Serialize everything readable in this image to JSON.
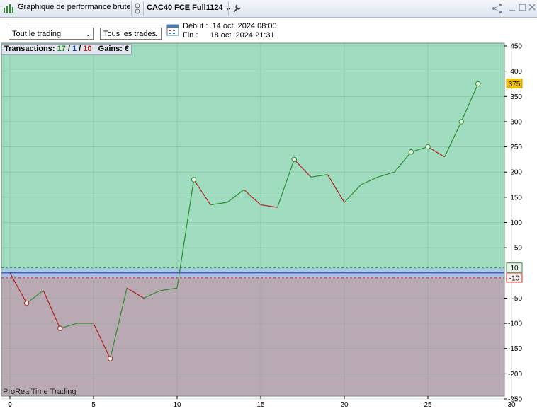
{
  "titlebar": {
    "window_title": "Graphique de performance brute",
    "instrument": "CAC40 FCE Full1124",
    "icons": [
      "bar-chart-icon",
      "scroll-icon",
      "wrench-icon",
      "share-icon",
      "minimize-icon",
      "maximize-icon",
      "close-icon"
    ]
  },
  "toolbar": {
    "scope_select": "Tout le trading",
    "trades_select": "Tous les trades",
    "start_label": "Début :",
    "start_value": "14 oct. 2024 08:00",
    "end_label": "Fin :",
    "end_value": "18 oct. 2024 21:31"
  },
  "stats": {
    "label": "Transactions:",
    "winning": "17",
    "sep1": "/",
    "neutral": "1",
    "sep2": "/",
    "losing": "10",
    "gains_label": "Gains: €"
  },
  "brand": "ProRealTime Trading",
  "colors": {
    "profit_zone": "#9fdcc0",
    "loss_zone": "#b9a9b3",
    "rising_line": "#2e8b2e",
    "falling_line": "#b02020",
    "current_badge": "#f2c200",
    "zero_band": "#a8c4f0"
  },
  "chart_data": {
    "type": "line",
    "x": [
      0,
      1,
      2,
      3,
      4,
      5,
      6,
      7,
      8,
      9,
      10,
      11,
      12,
      13,
      14,
      15,
      16,
      17,
      18,
      19,
      20,
      21,
      22,
      23,
      24,
      25,
      26,
      27,
      28
    ],
    "series": [
      {
        "values": [
          0,
          -60,
          -35,
          -110,
          -100,
          -100,
          -170,
          -30,
          -50,
          -35,
          -30,
          185,
          135,
          140,
          165,
          135,
          130,
          225,
          190,
          195,
          140,
          175,
          190,
          200,
          240,
          250,
          230,
          300,
          375
        ]
      }
    ],
    "markers_x": [
      1,
      3,
      6,
      11,
      17,
      24,
      25,
      27,
      28
    ],
    "xlim": [
      0,
      30
    ],
    "ylim": [
      -250,
      450
    ],
    "x_ticks": [
      0,
      5,
      10,
      15,
      20,
      25,
      30
    ],
    "y_ticks": [
      450,
      400,
      350,
      300,
      250,
      200,
      150,
      100,
      50,
      -50,
      -100,
      -150,
      -200,
      -250
    ],
    "threshold_upper": "10",
    "threshold_lower": "-10",
    "current_value": "375",
    "grid": true
  }
}
